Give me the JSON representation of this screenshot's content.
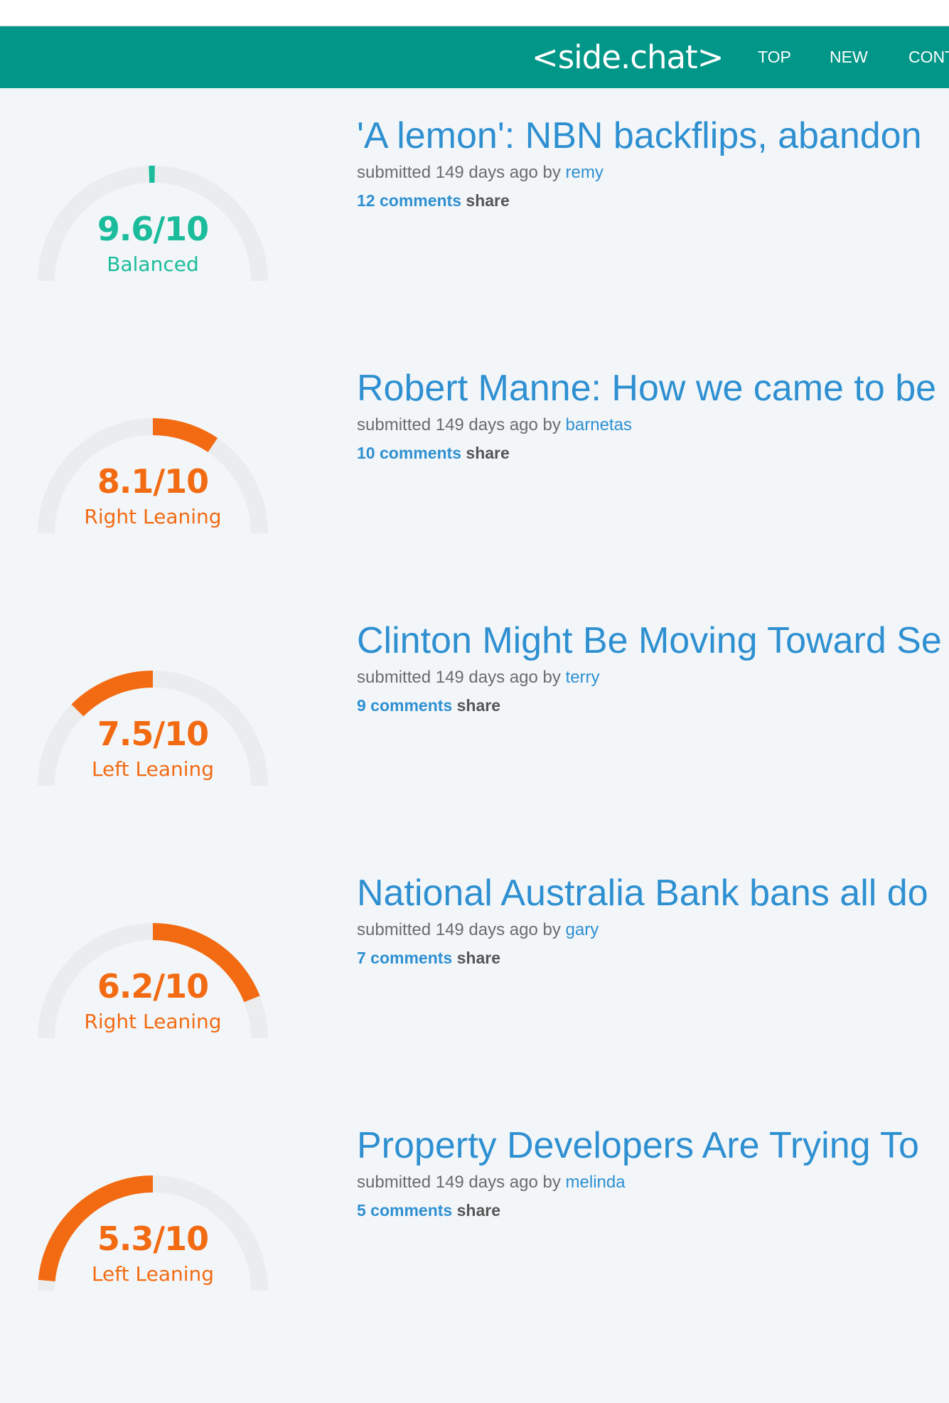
{
  "header": {
    "brand": "<side.chat>",
    "nav": [
      "TOP",
      "NEW",
      "CONT"
    ]
  },
  "colors": {
    "nav_bg": "#009688",
    "link": "#2e90d1",
    "balanced": "#1abc9c",
    "leaning": "#f26b13",
    "gauge_track": "#eaeced"
  },
  "posts": [
    {
      "score": "9.6/10",
      "score_value": 9.6,
      "lean": "Balanced",
      "lean_type": "balanced",
      "title": "'A lemon': NBN backflips, abandon",
      "meta_prefix": "submitted 149 days ago by",
      "user": "remy",
      "comments": "12 comments",
      "share": "share"
    },
    {
      "score": "8.1/10",
      "score_value": 8.1,
      "lean": "Right Leaning",
      "lean_type": "right",
      "title": "Robert Manne: How we came to be",
      "meta_prefix": "submitted 149 days ago by",
      "user": "barnetas",
      "comments": "10 comments",
      "share": "share"
    },
    {
      "score": "7.5/10",
      "score_value": 7.5,
      "lean": "Left Leaning",
      "lean_type": "left",
      "title": "Clinton Might Be Moving Toward Se",
      "meta_prefix": "submitted 149 days ago by",
      "user": "terry",
      "comments": "9 comments",
      "share": "share"
    },
    {
      "score": "6.2/10",
      "score_value": 6.2,
      "lean": "Right Leaning",
      "lean_type": "right",
      "title": "National Australia Bank bans all do",
      "meta_prefix": "submitted 149 days ago by",
      "user": "gary",
      "comments": "7 comments",
      "share": "share"
    },
    {
      "score": "5.3/10",
      "score_value": 5.3,
      "lean": "Left Leaning",
      "lean_type": "left",
      "title": "Property Developers Are Trying To",
      "meta_prefix": "submitted 149 days ago by",
      "user": "melinda",
      "comments": "5 comments",
      "share": "share"
    }
  ]
}
